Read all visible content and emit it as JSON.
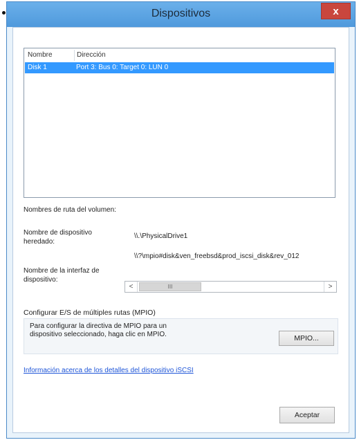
{
  "dialog": {
    "title": "Dispositivos",
    "close_glyph": "x"
  },
  "devices_list": {
    "columns": [
      "Nombre",
      "Dirección"
    ],
    "rows": [
      {
        "name": "Disk 1",
        "address": "Port 3: Bus 0: Target 0: LUN 0",
        "selected": true
      }
    ]
  },
  "details": {
    "volume_paths_label": "Nombres de ruta del volumen:",
    "legacy_name_label": "Nombre de dispositivo heredado:",
    "legacy_name_value": "\\\\.\\PhysicalDrive1",
    "interface_name_value": "\\\\?\\mpio#disk&ven_freebsd&prod_iscsi_disk&rev_012",
    "interface_name_label": "Nombre de la interfaz de dispositivo:",
    "scrollbar": {
      "left_arrow": "<",
      "right_arrow": ">",
      "thumb_grip": "III"
    }
  },
  "mpio": {
    "heading": "Configurar E/S de múltiples rutas (MPIO)",
    "description": "Para configurar la directiva de MPIO para un dispositivo seleccionado, haga clic en MPIO.",
    "button_label": "MPIO..."
  },
  "link_text": "Información acerca de los detalles del dispositivo iSCSI",
  "ok_button_label": "Aceptar",
  "colors": {
    "titlebar": "#5aa3e3",
    "selection": "#3399ff",
    "close": "#c9463d",
    "link": "#1e55d8"
  }
}
